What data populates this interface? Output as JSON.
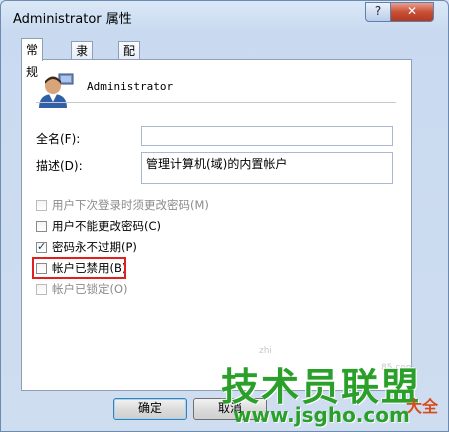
{
  "window": {
    "title": "Administrator 属性",
    "help_glyph": "?",
    "close_glyph": "✕"
  },
  "tabs": [
    {
      "label": "常规"
    },
    {
      "label": "隶属于"
    },
    {
      "label": "配置文件"
    }
  ],
  "general": {
    "username": "Administrator",
    "fullname_label": "全名(F):",
    "fullname_value": "",
    "description_label": "描述(D):",
    "description_value": "管理计算机(域)的内置帐户"
  },
  "checkboxes": [
    {
      "label": "用户下次登录时须更改密码(M)",
      "checked": false,
      "enabled": false
    },
    {
      "label": "用户不能更改密码(C)",
      "checked": false,
      "enabled": true
    },
    {
      "label": "密码永不过期(P)",
      "checked": true,
      "enabled": true
    },
    {
      "label": "帐户已禁用(B)",
      "checked": false,
      "enabled": true
    },
    {
      "label": "帐户已锁定(O)",
      "checked": false,
      "enabled": false
    }
  ],
  "buttons": {
    "ok": "确定",
    "cancel": "取消"
  },
  "watermark": {
    "main": "技术员联盟",
    "url": "www.jsgho.com",
    "tail": "大全",
    "faint_mid": "zhi",
    "faint_right": "85.com"
  },
  "colors": {
    "highlight": "#e01f1f",
    "watermark": "#2aa02a"
  }
}
